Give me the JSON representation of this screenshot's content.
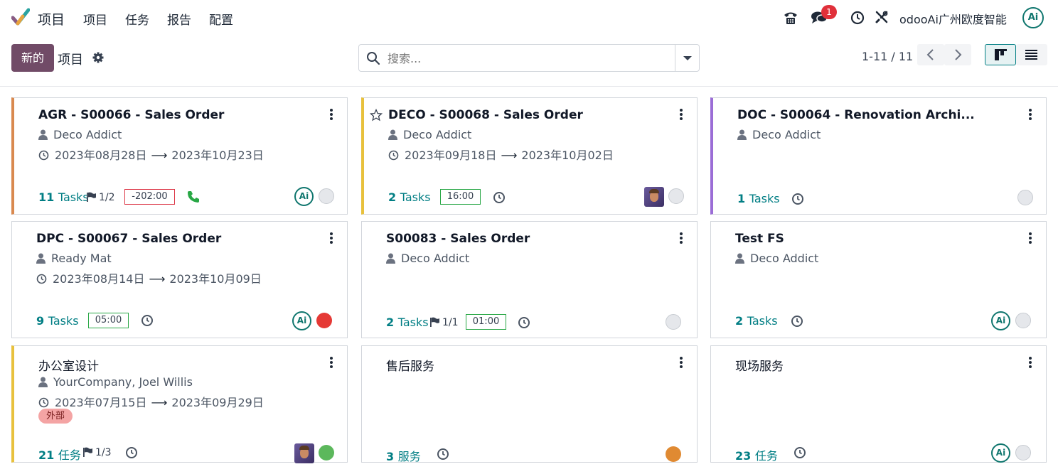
{
  "navbar": {
    "app_name": "项目",
    "menu": [
      "项目",
      "任务",
      "报告",
      "配置"
    ],
    "message_count": "1",
    "company": "odooAi广州欧度智能",
    "user_avatar": "Ai"
  },
  "control_panel": {
    "new_label": "新的",
    "title": "项目",
    "search_placeholder": "搜索...",
    "pager": "1-11 / 11"
  },
  "colors": {
    "primary": "#714b67",
    "accent": "#017e84",
    "orange": "#d9894f",
    "yellow": "#e8c13d",
    "purple": "#9b6dd6"
  },
  "cards": [
    {
      "title": "AGR - S00066 - Sales Order",
      "customer": "Deco Addict",
      "date_start": "2023年08月28日",
      "date_end": "2023年10月23日",
      "tasks_count": "11",
      "tasks_label": "Tasks",
      "milestone": "1/2",
      "timesheet": "-202:00",
      "status": "grey"
    },
    {
      "title": "DECO - S00068 - Sales Order",
      "customer": "Deco Addict",
      "date_start": "2023年09月18日",
      "date_end": "2023年10月02日",
      "tasks_count": "2",
      "tasks_label": "Tasks",
      "timesheet": "16:00",
      "status": "grey"
    },
    {
      "title": "DOC - S00064 - Renovation Archi...",
      "customer": "Deco Addict",
      "tasks_count": "1",
      "tasks_label": "Tasks",
      "status": "grey"
    },
    {
      "title": "DPC - S00067 - Sales Order",
      "customer": "Ready Mat",
      "date_start": "2023年08月14日",
      "date_end": "2023年10月09日",
      "tasks_count": "9",
      "tasks_label": "Tasks",
      "timesheet": "05:00",
      "status": "red"
    },
    {
      "title": "S00083 - Sales Order",
      "customer": "Deco Addict",
      "tasks_count": "2",
      "tasks_label": "Tasks",
      "milestone": "1/1",
      "timesheet": "01:00",
      "status": "grey"
    },
    {
      "title": "Test FS",
      "customer": "Deco Addict",
      "tasks_count": "2",
      "tasks_label": "Tasks",
      "status": "grey"
    },
    {
      "title": "办公室设计",
      "customer": "YourCompany, Joel Willis",
      "date_start": "2023年07月15日",
      "date_end": "2023年09月29日",
      "tag": "外部",
      "tasks_count": "21",
      "tasks_label": "任务",
      "milestone": "1/3",
      "status": "green"
    },
    {
      "title": "售后服务",
      "tasks_count": "3",
      "tasks_label": "服务",
      "status": "orange"
    },
    {
      "title": "现场服务",
      "tasks_count": "23",
      "tasks_label": "任务",
      "status": "grey"
    }
  ]
}
